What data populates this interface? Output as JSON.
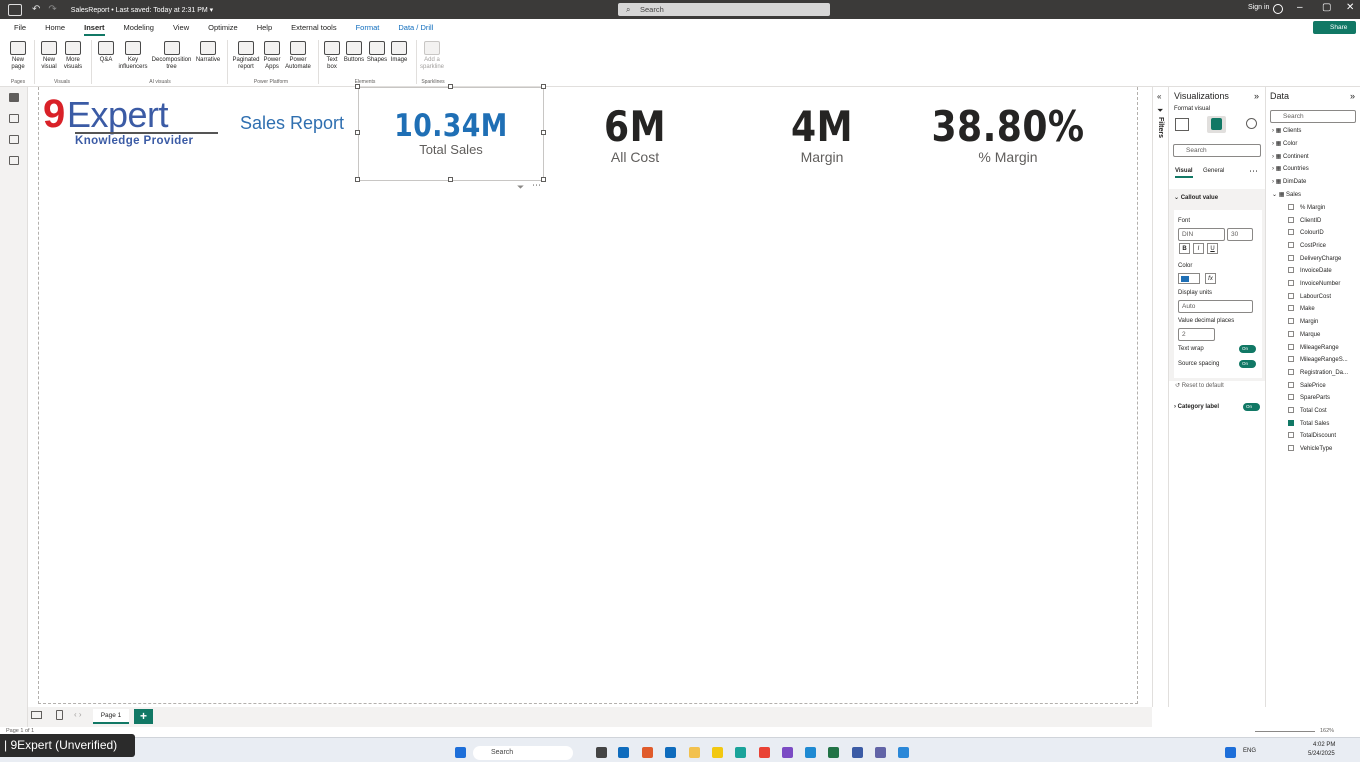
{
  "titlebar": {
    "doc_title": "SalesReport • Last saved: Today at 2:31 PM ▾",
    "search_placeholder": "Search",
    "sign_in": "Sign in"
  },
  "menu": {
    "items": [
      "File",
      "Home",
      "Insert",
      "Modeling",
      "View",
      "Optimize",
      "Help",
      "External tools",
      "Format",
      "Data / Drill"
    ],
    "active": "Insert",
    "share": "Share"
  },
  "ribbon": {
    "buttons": [
      "New page",
      "New visual",
      "More visuals",
      "Q&A",
      "Key influencers",
      "Decomposition tree",
      "Narrative",
      "Paginated report",
      "Power Apps",
      "Power Automate",
      "Text box",
      "Buttons",
      "Shapes",
      "Image",
      "Add a sparkline"
    ],
    "groups": [
      "Pages",
      "Visuals",
      "AI visuals",
      "Power Platform",
      "Elements",
      "Sparklines"
    ]
  },
  "report": {
    "logo_main": "9Expert",
    "logo_sub": "Knowledge Provider",
    "title": "Sales Report",
    "cards": [
      {
        "value": "10.34M",
        "label": "Total Sales"
      },
      {
        "value": "6M",
        "label": "All Cost"
      },
      {
        "value": "4M",
        "label": "Margin"
      },
      {
        "value": "38.80%",
        "label": "% Margin"
      }
    ],
    "page_tab": "Page 1"
  },
  "filters": {
    "label": "Filters"
  },
  "viz": {
    "title": "Visualizations",
    "format_visual": "Format visual",
    "search": "Search",
    "tabs": [
      "Visual",
      "General"
    ],
    "section": "Callout value",
    "font_label": "Font",
    "font_name": "DIN",
    "font_size": "30",
    "color_label": "Color",
    "display_units_label": "Display units",
    "display_units": "Auto",
    "decimal_label": "Value decimal places",
    "decimal_value": "2",
    "text_wrap": "Text wrap",
    "source_spacing": "Source spacing",
    "toggle_on": "On",
    "reset": "Reset to default",
    "category_label": "Category label",
    "accent_color": "#117865"
  },
  "data": {
    "title": "Data",
    "search": "Search",
    "tables": [
      "Clients",
      "Color",
      "Continent",
      "Countries",
      "DimDate",
      "Sales"
    ],
    "fields": [
      {
        "name": "% Margin",
        "checked": false
      },
      {
        "name": "ClientID",
        "checked": false
      },
      {
        "name": "ColourID",
        "checked": false
      },
      {
        "name": "CostPrice",
        "checked": false
      },
      {
        "name": "DeliveryCharge",
        "checked": false
      },
      {
        "name": "InvoiceDate",
        "checked": false
      },
      {
        "name": "InvoiceNumber",
        "checked": false
      },
      {
        "name": "LabourCost",
        "checked": false
      },
      {
        "name": "Make",
        "checked": false
      },
      {
        "name": "Margin",
        "checked": false
      },
      {
        "name": "Marque",
        "checked": false
      },
      {
        "name": "MileageRange",
        "checked": false
      },
      {
        "name": "MileageRangeS...",
        "checked": false
      },
      {
        "name": "Registration_Da...",
        "checked": false
      },
      {
        "name": "SalePrice",
        "checked": false
      },
      {
        "name": "SpareParts",
        "checked": false
      },
      {
        "name": "Total Cost",
        "checked": false
      },
      {
        "name": "Total Sales",
        "checked": true
      },
      {
        "name": "TotalDiscount",
        "checked": false
      },
      {
        "name": "VehicleType",
        "checked": false
      }
    ]
  },
  "status": {
    "page": "Page 1 of 1",
    "zoom": "162%",
    "toast": "| 9Expert (Unverified)"
  },
  "taskbar": {
    "search": "Search",
    "lang": "ENG",
    "time": "4:02 PM",
    "date": "5/24/2025"
  }
}
